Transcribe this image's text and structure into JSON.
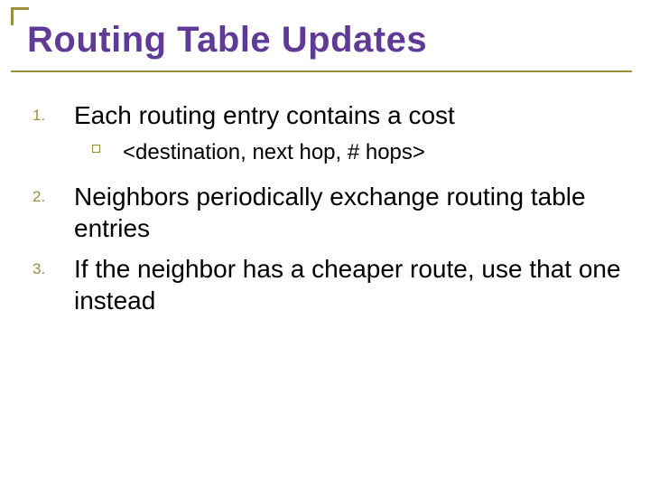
{
  "title": "Routing Table Updates",
  "items": {
    "n1": {
      "num": "1.",
      "text": "Each routing entry contains a cost"
    },
    "sub": {
      "text": "<destination, next hop, # hops>"
    },
    "n2": {
      "num": "2.",
      "text": "Neighbors periodically exchange routing table entries"
    },
    "n3": {
      "num": "3.",
      "text": "If the neighbor has a cheaper route, use that one instead"
    }
  }
}
